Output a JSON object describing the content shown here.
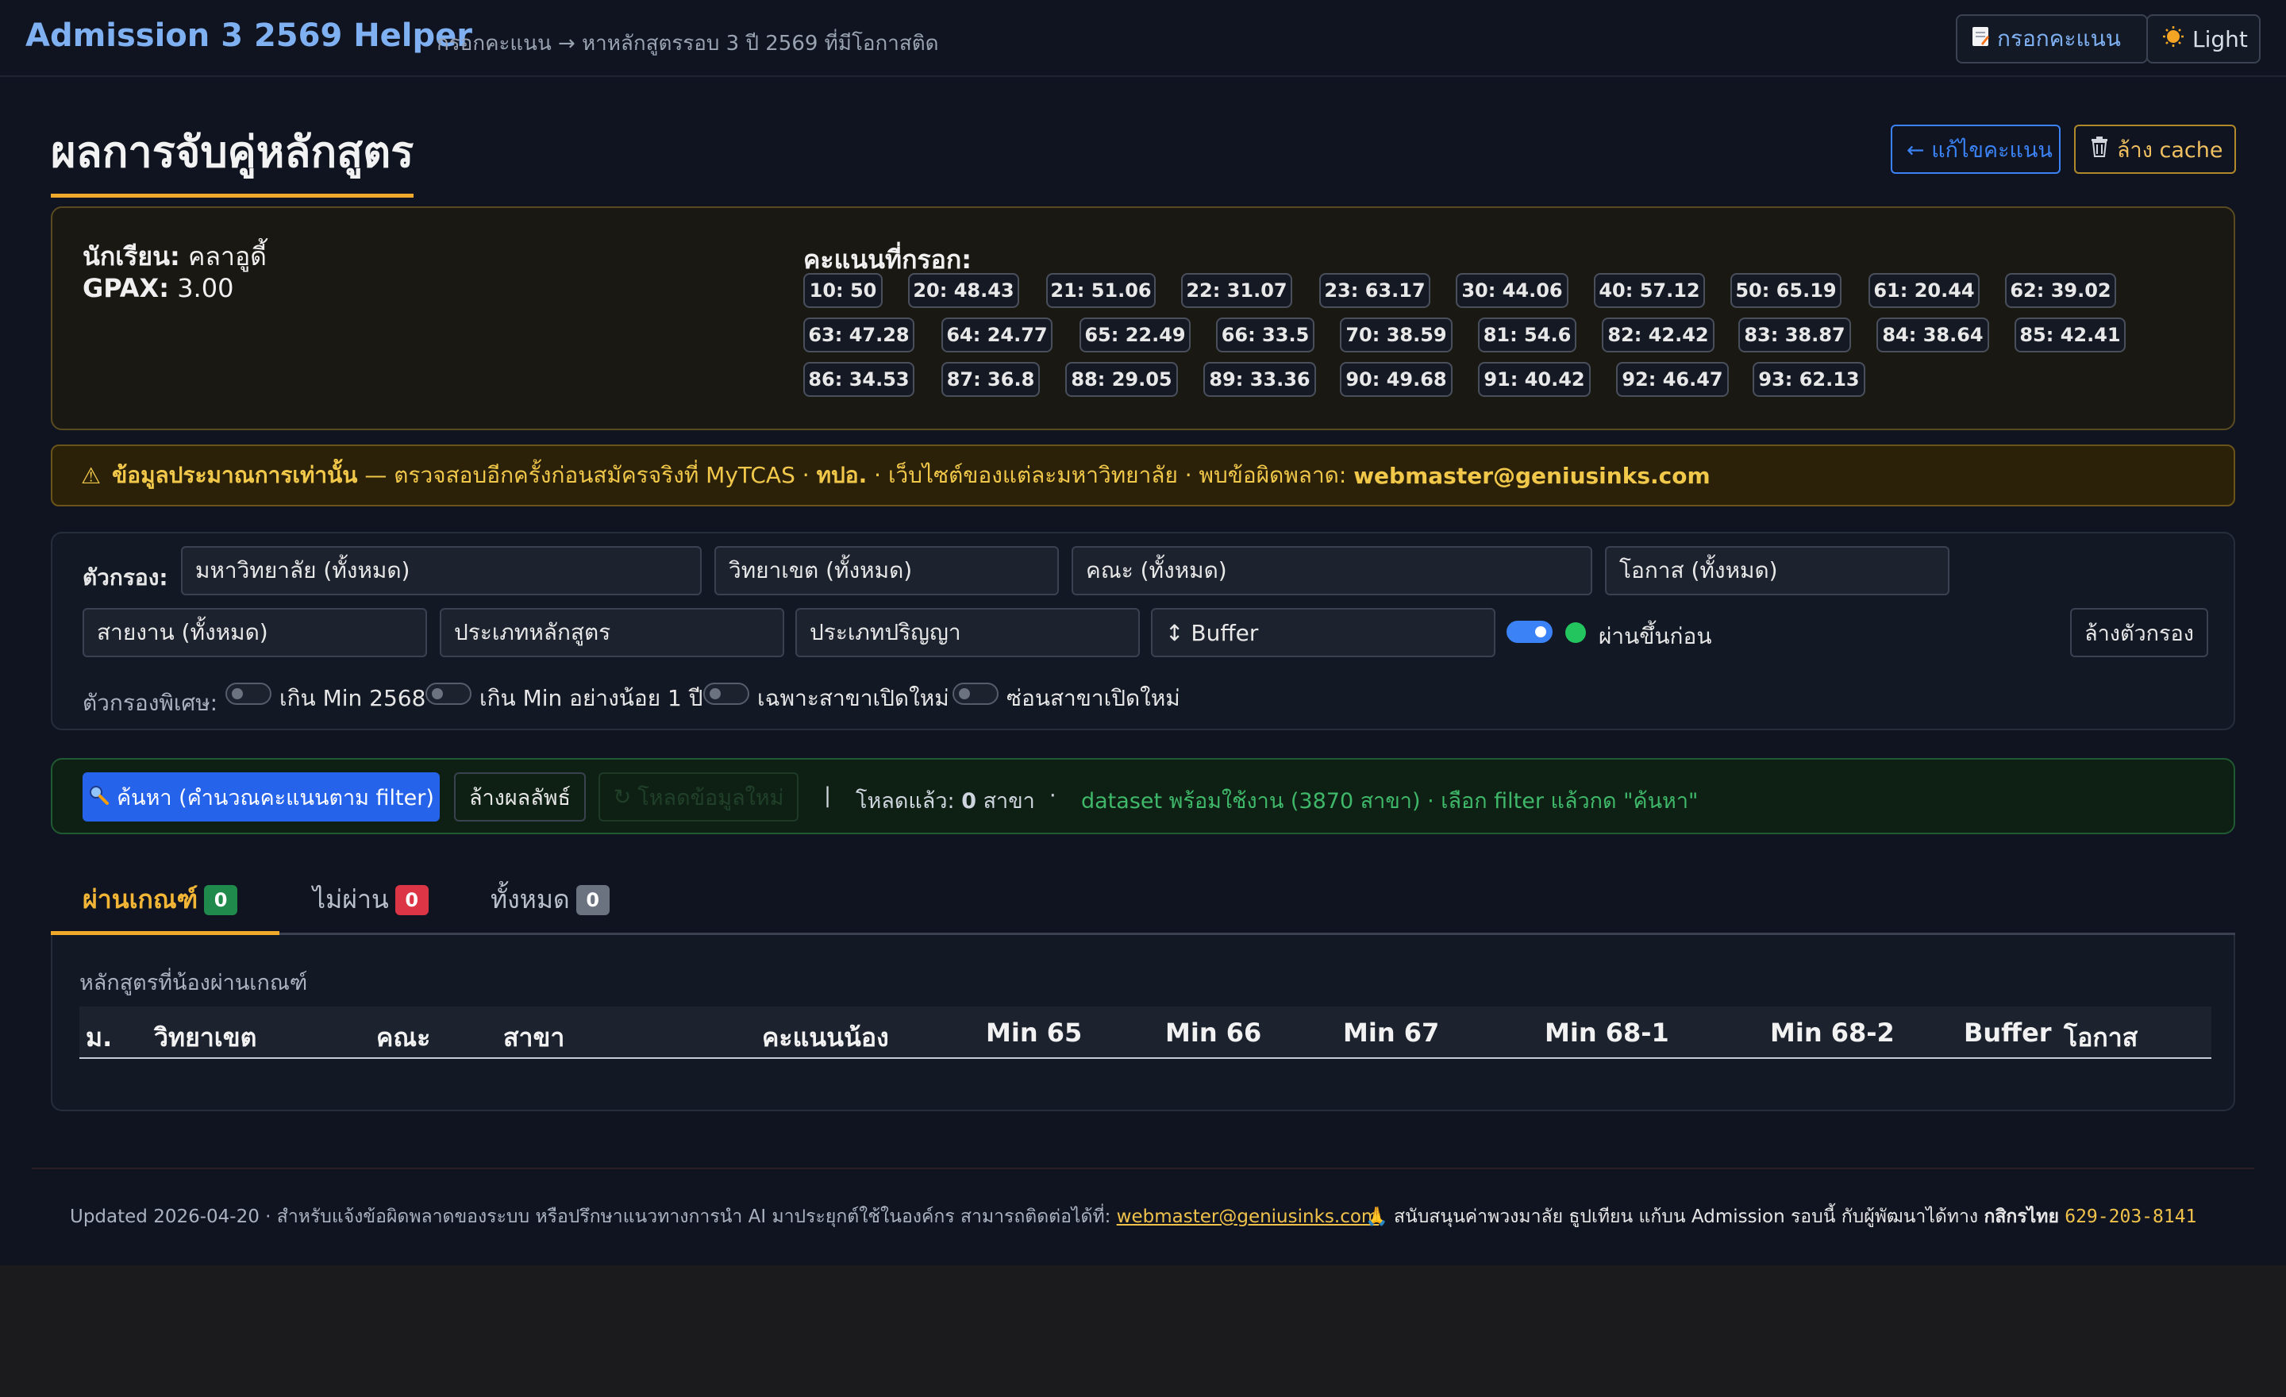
{
  "header": {
    "brand": "Admission 3 2569 Helper",
    "tagline": "กรอกคะแนน → หาหลักสูตรรอบ 3 ปี 2569 ที่มีโอกาสติด",
    "enter_scores_label": "กรอกคะแนน",
    "theme_label": "Light"
  },
  "page": {
    "title": "ผลการจับคู่หลักสูตร",
    "edit_scores_label": "← แก้ไขคะแนน",
    "clear_cache_label": "ล้าง cache"
  },
  "student": {
    "name_label": "นักเรียน:",
    "name": "คลาอูดี้",
    "gpax_label": "GPAX:",
    "gpax": "3.00",
    "scores_label": "คะแนนที่กรอก:",
    "scores": [
      "10: 50",
      "20: 48.43",
      "21: 51.06",
      "22: 31.07",
      "23: 63.17",
      "30: 44.06",
      "40: 57.12",
      "50: 65.19",
      "61: 20.44",
      "62: 39.02",
      "63: 47.28",
      "64: 24.77",
      "65: 22.49",
      "66: 33.5",
      "70: 38.59",
      "81: 54.6",
      "82: 42.42",
      "83: 38.87",
      "84: 38.64",
      "85: 42.41",
      "86: 34.53",
      "87: 36.8",
      "88: 29.05",
      "89: 33.36",
      "90: 49.68",
      "91: 40.42",
      "92: 46.47",
      "93: 62.13"
    ]
  },
  "warning": {
    "icon": "⚠",
    "strong": "ข้อมูลประมาณการเท่านั้น",
    "text_a": " — ตรวจสอบอีกครั้งก่อนสมัครจริงที่ MyTCAS · ",
    "strong2": "ทปอ.",
    "text_b": " · เว็บไซต์ของแต่ละมหาวิทยาลัย · พบข้อผิดพลาด: ",
    "email": "webmaster@geniusinks.com"
  },
  "filters": {
    "label": "ตัวกรอง:",
    "university": "มหาวิทยาลัย (ทั้งหมด)",
    "campus": "วิทยาเขต (ทั้งหมด)",
    "faculty": "คณะ (ทั้งหมด)",
    "chance": "โอกาส (ทั้งหมด)",
    "stream": "สายงาน (ทั้งหมด)",
    "program_type": "ประเภทหลักสูตร",
    "degree_type": "ประเภทปริญญา",
    "buffer": "↕ Buffer",
    "pass_first_label": "ผ่านขึ้นก่อน",
    "pass_first_on": true,
    "clear_filters_label": "ล้างตัวกรอง",
    "special_label": "ตัวกรองพิเศษ:",
    "special": [
      {
        "label": "เกิน Min 2568",
        "on": false
      },
      {
        "label": "เกิน Min อย่างน้อย 1 ปี",
        "on": false
      },
      {
        "label": "เฉพาะสาขาเปิดใหม่",
        "on": false
      },
      {
        "label": "ซ่อนสาขาเปิดใหม่",
        "on": false
      }
    ]
  },
  "search": {
    "search_label": "ค้นหา (คำนวณคะแนนตาม filter)",
    "clear_results_label": "ล้างผลลัพธ์",
    "load_label": "โหลดข้อมูลใหม่",
    "separator": "|",
    "loaded_label": "โหลดแล้ว:",
    "loaded_count": "0",
    "loaded_unit": "สาขา",
    "dot": "·",
    "status": "dataset พร้อมใช้งาน (3870 สาขา) · เลือก filter แล้วกด \"ค้นหา\""
  },
  "tabs": [
    {
      "label": "ผ่านเกณฑ์",
      "count": "0",
      "color": "#1f8a4c"
    },
    {
      "label": "ไม่ผ่าน",
      "count": "0",
      "color": "#dc3545"
    },
    {
      "label": "ทั้งหมด",
      "count": "0",
      "color": "#6b7280"
    }
  ],
  "results": {
    "caption": "หลักสูตรที่น้องผ่านเกณฑ์",
    "columns": [
      "ม.",
      "วิทยาเขต",
      "คณะ",
      "สาขา",
      "คะแนนน้อง",
      "Min 65",
      "Min 66",
      "Min 67",
      "Min 68-1",
      "Min 68-2",
      "Buffer",
      "โอกาส"
    ],
    "rows": []
  },
  "footer": {
    "left_text": "Updated 2026-04-20 · สำหรับแจ้งข้อผิดพลาดของระบบ หรือปรึกษาแนวทางการนำ AI มาประยุกต์ใช้ในองค์กร สามารถติดต่อได้ที่: ",
    "email": "webmaster@geniusinks.com",
    "right_icon": "🙏",
    "right_text": " สนับสนุนค่าพวงมาลัย ธูปเทียน แก้บน Admission รอบนี้ กับผู้พัฒนาได้ทาง ",
    "bank": "กสิกรไทย",
    "account": "629-203-8141"
  },
  "colors": {
    "accent_orange": "#f0a92a",
    "accent_blue": "#3b82f6",
    "success": "#22c55e",
    "danger": "#dc3545"
  }
}
